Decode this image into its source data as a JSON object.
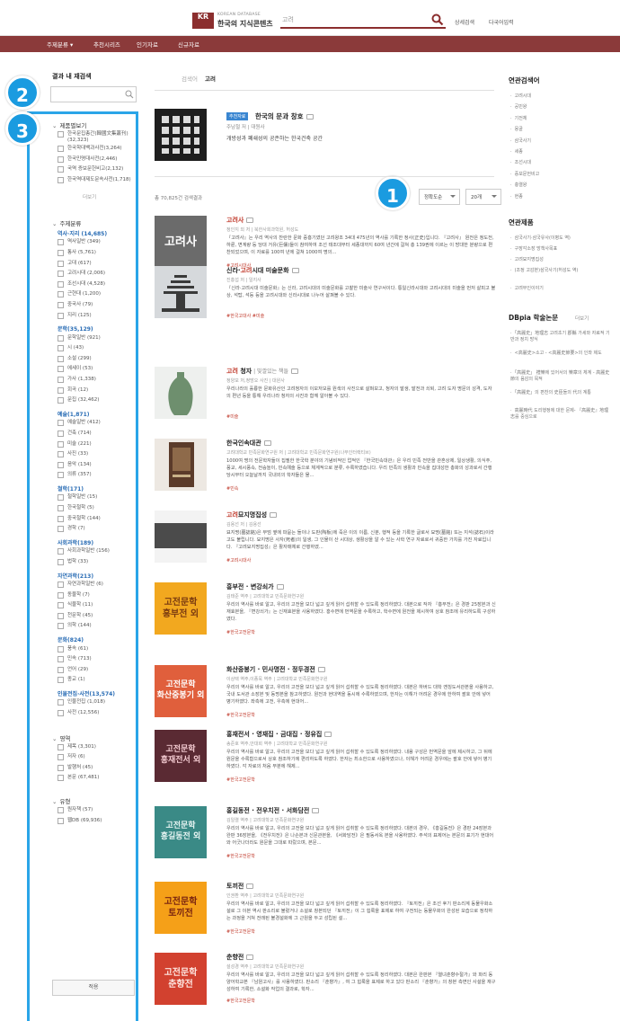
{
  "header": {
    "logo_mark": "KR",
    "logo_en": "KOREAN DATABASE",
    "logo_ko": "한국의 지식콘텐츠",
    "search_value": "고려",
    "detail_search": "상세검색",
    "multi_input": "다국어입력"
  },
  "nav": {
    "items": [
      "주제분류",
      "추천시리즈",
      "인기자료",
      "신규자료"
    ]
  },
  "filter": {
    "title": "결과 내 재검색",
    "input_placeholder": ""
  },
  "badges": [
    "1",
    "2",
    "3"
  ],
  "facets": {
    "type_head": "제품별보기",
    "type_items": [
      "한국문집총간(韓國文集叢刊)(32,323)",
      "한국학대백과사전(3,264)",
      "한국민명대사전(2,446)",
      "국역 증보문헌비고(2,132)",
      "한국역대제도문속사전(1,718)"
    ],
    "type_more": "더보기",
    "subject_head": "주제분류",
    "groups": [
      {
        "name": "역사·지리 (14,685)",
        "items": [
          "역사일반 (349)",
          "통사 (5,761)",
          "고대 (617)",
          "고려시대 (2,006)",
          "조선시대 (4,528)",
          "근현대 (1,200)",
          "중국사 (79)",
          "지리 (125)"
        ]
      },
      {
        "name": "문학(35,129)",
        "items": [
          "문학일반 (921)",
          "시 (43)",
          "소설 (299)",
          "에세이 (53)",
          "가사 (1,338)",
          "회곡 (12)",
          "문집 (32,462)"
        ]
      },
      {
        "name": "예술(1,871)",
        "items": [
          "예술일반 (412)",
          "건축 (714)",
          "미술 (221)",
          "사진 (33)",
          "음악 (134)",
          "의류 (357)"
        ]
      },
      {
        "name": "철학(171)",
        "items": [
          "철학일반 (15)",
          "한국철학 (5)",
          "중국철학 (144)",
          "경학 (7)"
        ]
      },
      {
        "name": "사회과학(189)",
        "items": [
          "사회과학일반 (156)",
          "법학 (33)"
        ]
      },
      {
        "name": "자연과학(213)",
        "items": [
          "자연과학일반 (6)",
          "동물학 (7)",
          "식물학 (11)",
          "천문학 (45)",
          "의학 (144)"
        ]
      },
      {
        "name": "문화(824)",
        "items": [
          "풍속 (61)",
          "민속 (713)",
          "언어 (29)",
          "종교 (1)"
        ]
      },
      {
        "name": "인물전집·사전(13,574)",
        "items": [
          "인물전집 (1,018)",
          "사전 (12,556)"
        ]
      }
    ],
    "area_head": "영역",
    "area_items": [
      "제목 (3,301)",
      "저자 (6)",
      "발행처 (45)",
      "본문 (67,481)"
    ],
    "format_head": "유형",
    "format_items": [
      "원자책 (57)",
      "웹DB (69,936)"
    ],
    "apply": "적용"
  },
  "center": {
    "tab_all": "검색어",
    "tab_query": "고려",
    "featured": {
      "tag": "추천자료",
      "title": "한국의 문과 창호",
      "meta": "주남철 저 | 대원사",
      "desc": "개방성과 폐쇄성의 공존하는 한국건축 공간"
    },
    "count": "총 70,825건 검색결과",
    "sort": "정확도순",
    "per_page": "20개"
  },
  "results": [
    {
      "thumb_text": "고려사",
      "title_pre": "",
      "title_hl": "고려사",
      "title_post": "",
      "extra": "",
      "meta": "정인지 외 저 | 북한사회과학원, 허성도",
      "desc": "『고려사』는 우리 역사의 찬란한 문화 중흥기였던 고려왕조 34대 475년의 역사를 기록한 정사(正史)입니다. 『고려사』 원전은 정도전, 하륜, 변계량 등 당대 거유(巨儒)들이 참여하여 조선 태조대부터 세종대까지 60여 년간에 걸쳐 총 139권에 이르는 이 방대한 분량으로 편찬되었으며, 이 자료를 100여 년에 걸쳐 1000여 명의...",
      "tag": "#고려시대사"
    },
    {
      "thumb_text": "",
      "title_pre": "신라·",
      "title_hl": "고려",
      "title_post": "시대 미술문화",
      "extra": "",
      "meta": "진홍섭 저 | 일지사",
      "desc": "『신라·고려시대 미술문화』는 신라, 고려시대의 미술문화를 고찰한 미술사 연구서이다. 통일신라시대와 고려시대의 미술을 먼저 살피고 불상, 석탑, 석등 등을 고려시대와 신라시대로 나누어 살펴볼 수 있다.",
      "tag": "#한국고대사  #미술"
    },
    {
      "thumb_text": "",
      "title_pre": "",
      "title_hl": "고려",
      "title_post": " 청자",
      "extra": " | 빛깔있는 책들",
      "meta": "정양모 저,정방오 사진 | 대원사",
      "desc": "우리나라의 훌륭한 문화유산인 고려청자의 이모저모를 원색의 사진으로 살펴보고, 청자의 발생, 발전과 쇠퇴, 고려 도자 명문의 성격, 도자의 편년 등을 통해 우리나라 청자의 사진과 함께 알아볼 수 있다.",
      "tag": "#미술"
    },
    {
      "thumb_text": "",
      "title_pre": "한국인",
      "title_hl": "",
      "title_post": "속대관",
      "extra": "",
      "meta": "고려대학교 민족문화연구원 저 | 고려대학교 민족문화연구원(나무인터랙티브)",
      "desc": "1000여 명의 전문학자들이 집필한 한국학 분야의 기념비적인 업적인 『한국민속대관』은 우리 민족 전반을 관혼상제, 일상생활, 의식주, 풍교, 세시풍속, 전승놀이, 민속예술 등으로 체계적으로 분류, 수록하였습니다. 우리 민족의 생활과 민속을 집대성한 총화의 성과로서 간행 당시부터 오늘날까지 국내외의 학자들은 물...",
      "tag": "#민속"
    },
    {
      "thumb_text": "",
      "title_pre": "",
      "title_hl": "고려",
      "title_post": "묘지명집성",
      "extra": "",
      "meta": "김용선 저 | 김용선",
      "desc": "묘지명(墓誌銘)은 무덤 옆에 파묻는 돌이나 도판(陶板)에 죽은 이의 이름, 신분, 행적 등을 기록한 글로서 묘명(墓銘) 또는 지석(誌石)이라고도 불립니다. 묘지명은 사자(死者)의 일생, 그 인물이 산 시대상, 생활상을 알 수 있는 사학 연구 자료로서 귀중한 가치를 가진 자료입니다. 『고려묘지명집성』은 활자매체로 간행하였...",
      "tag": "#고려시대사"
    },
    {
      "thumb_text": "고전문학\n흥부전 외",
      "title_pre": "흥부전 · 변강쇠가",
      "title_hl": "",
      "title_post": "",
      "extra": "",
      "meta": "김태준 역주 | 고려대학교 민족문화연구원",
      "desc": "우리의 역사를 바로 알고, 우리의 고전을 보다 넓고 깊게 읽어 섭취할 수 있도록 정리하였다. 대본으로 작자 『흥부전』은 경판 25장본과 신재효본을, 『변강쇠가』는 신재효본을 사용하였다. 홍수면에 번역문을 수록하고, 학수면에 원전을 제시하여 상호 참조에 유리하도록 구성하였다.",
      "tag": "#한국고전문학"
    },
    {
      "thumb_text": "고전문학\n화산중봉기 외",
      "title_pre": "화산중봉기 · 민사명전 · 정두경전",
      "title_hl": "",
      "title_post": "",
      "extra": "",
      "meta": "이상택 역주,이종묵 역주 | 고려대학교 민족문화연구원",
      "desc": "우리의 역사를 바로 알고, 우리의 고전을 보다 넓고 깊게 읽어 섭취할 수 있도록 정리하였다. 대본은 하버드 대학 옌칭도서관본을 사용하고, 국내 도서관 소장본 및 동명본을 참고하였다. 원전과 현대역을 동시에 수록하였으며, 한자는 이해가 어려운 경우에 한하여 괄호 안에 넣어 병기하였다. 좌측에 고전, 우측에 현대어...",
      "tag": "#한국고전문학"
    },
    {
      "thumb_text": "고전문학\n홍재전서 외",
      "title_pre": "홍재전서 · 영재집 · 금대집 · 정유집",
      "title_hl": "",
      "title_post": "",
      "extra": "",
      "meta": "송준호 역주,안대회 역주 | 고려대학교 민족문화연구원",
      "desc": "우리의 역사를 바로 알고, 우리의 고전을 보다 넓고 깊게 읽어 섭취할 수 있도록 정리하였다. 내용 구성은 번역문을 앞에 제시하고, 그 뒤에 원문을 수록함으로서 상호 참조하기에 편리하도록 하였다. 한자는 최소한으로 사용하였으나, 이해가 어려운 경우에는 괄호 안에 넣어 병기하였다. 각 자료의 처음 부분에 해제...",
      "tag": "#한국고전문학"
    },
    {
      "thumb_text": "고전문학\n홍길동전 외",
      "title_pre": "홍길동전 · 전우치전 · 서화담전",
      "title_hl": "",
      "title_post": "",
      "extra": "",
      "meta": "김일렬 역주 | 고려대학교 민족문화연구원",
      "desc": "우리의 역사를 바로 알고, 우리의 고전을 보다 넓고 깊게 읽어 섭취할 수 있도록 정리하였다. 대본의 경우, 《홍길동전》은 경판 24장본과 완판 36장본을, 《전우치전》은 나손본과 신문관본을, 《서화담전》은 필동서옥 본을 사용하였다. 주석의 표제어는 본문의 표기가 현대어와 어긋나더라도 원문을 그대로 따랐으며, 본문...",
      "tag": "#한국고전문학"
    },
    {
      "thumb_text": "고전문학\n토끼전",
      "title_pre": "토끼전",
      "title_hl": "",
      "title_post": "",
      "extra": "",
      "meta": "인권환 역주 | 고려대학교 민족문화연구원",
      "desc": "우리의 역사를 바로 알고, 우리의 고전을 보다 넓고 깊게 읽어 섭취할 수 있도록 정리하였다. 『토끼전』은 조선 후기 판소리계 동물우화소설로 그 이본 역시 판소리로 불렸거나 소설로 창본되던 『토끼전』이 그 힘룩을 표제로 하여 구전되는 동물우화의 완성된 모습으로 정착하는 과정을 거쳐 전래된 불경설화에 그 근원을 두고 성립된 설...",
      "tag": "#한국고전문학"
    },
    {
      "thumb_text": "고전문학\n춘향전",
      "title_pre": "춘향전",
      "title_hl": "",
      "title_post": "",
      "extra": "",
      "meta": "설성경 역주 | 고려대학교 민족문화연구원",
      "desc": "우리의 역사를 바로 알고, 우리의 고전을 보다 넓고 깊게 읽어 섭취할 수 있도록 정리하였다. 대본은 완판본 『열녀춘향수절가』와 파리 동양어학교본 『남원고사』를 사용하였다. 판소리 『춘향가』, 여 그 힘룩을 표제로 하고 있다 판소리 『춘향가』의 창본 측면인 사설을 재구성하여 기록한, 소설화 작업의 결과로, 학자...",
      "tag": "#한국고전문학"
    }
  ],
  "sidebar": {
    "related_search_title": "연관검색어",
    "related_search": [
      "고려시대",
      "공민왕",
      "기전체",
      "몽골",
      "삼국사기",
      "세종",
      "조선시대",
      "증보문헌비고",
      "충렬왕",
      "현종"
    ],
    "related_products_title": "연관제품",
    "related_products": [
      "삼국사기·삼국유사(이병도 역)",
      "구장각소장 방책사목표",
      "고려묘지명집성",
      "(조정 고감본)삼국사기(허성도 역)",
      "고려무인이야기"
    ],
    "dbpia_title": "DBpia 학술논문",
    "dbpia_more": "더보기",
    "dbpia": [
      "「高麗史」地理志 고려초기 郡縣 가세와 자료적 기반과 정치 방식",
      "<高麗史>소고 - <高麗史節要>의 인좌 제도",
      "「高麗史」 禮樂에 있어서의 樂章의 체계 - 高麗史 節의 음감의 목적",
      "「高麗史」의 편찬의 史臣들의 代의 계통",
      "高麗時代 도리행정에 대한 문제- 『高麗史』地理志를 중심으로"
    ]
  }
}
